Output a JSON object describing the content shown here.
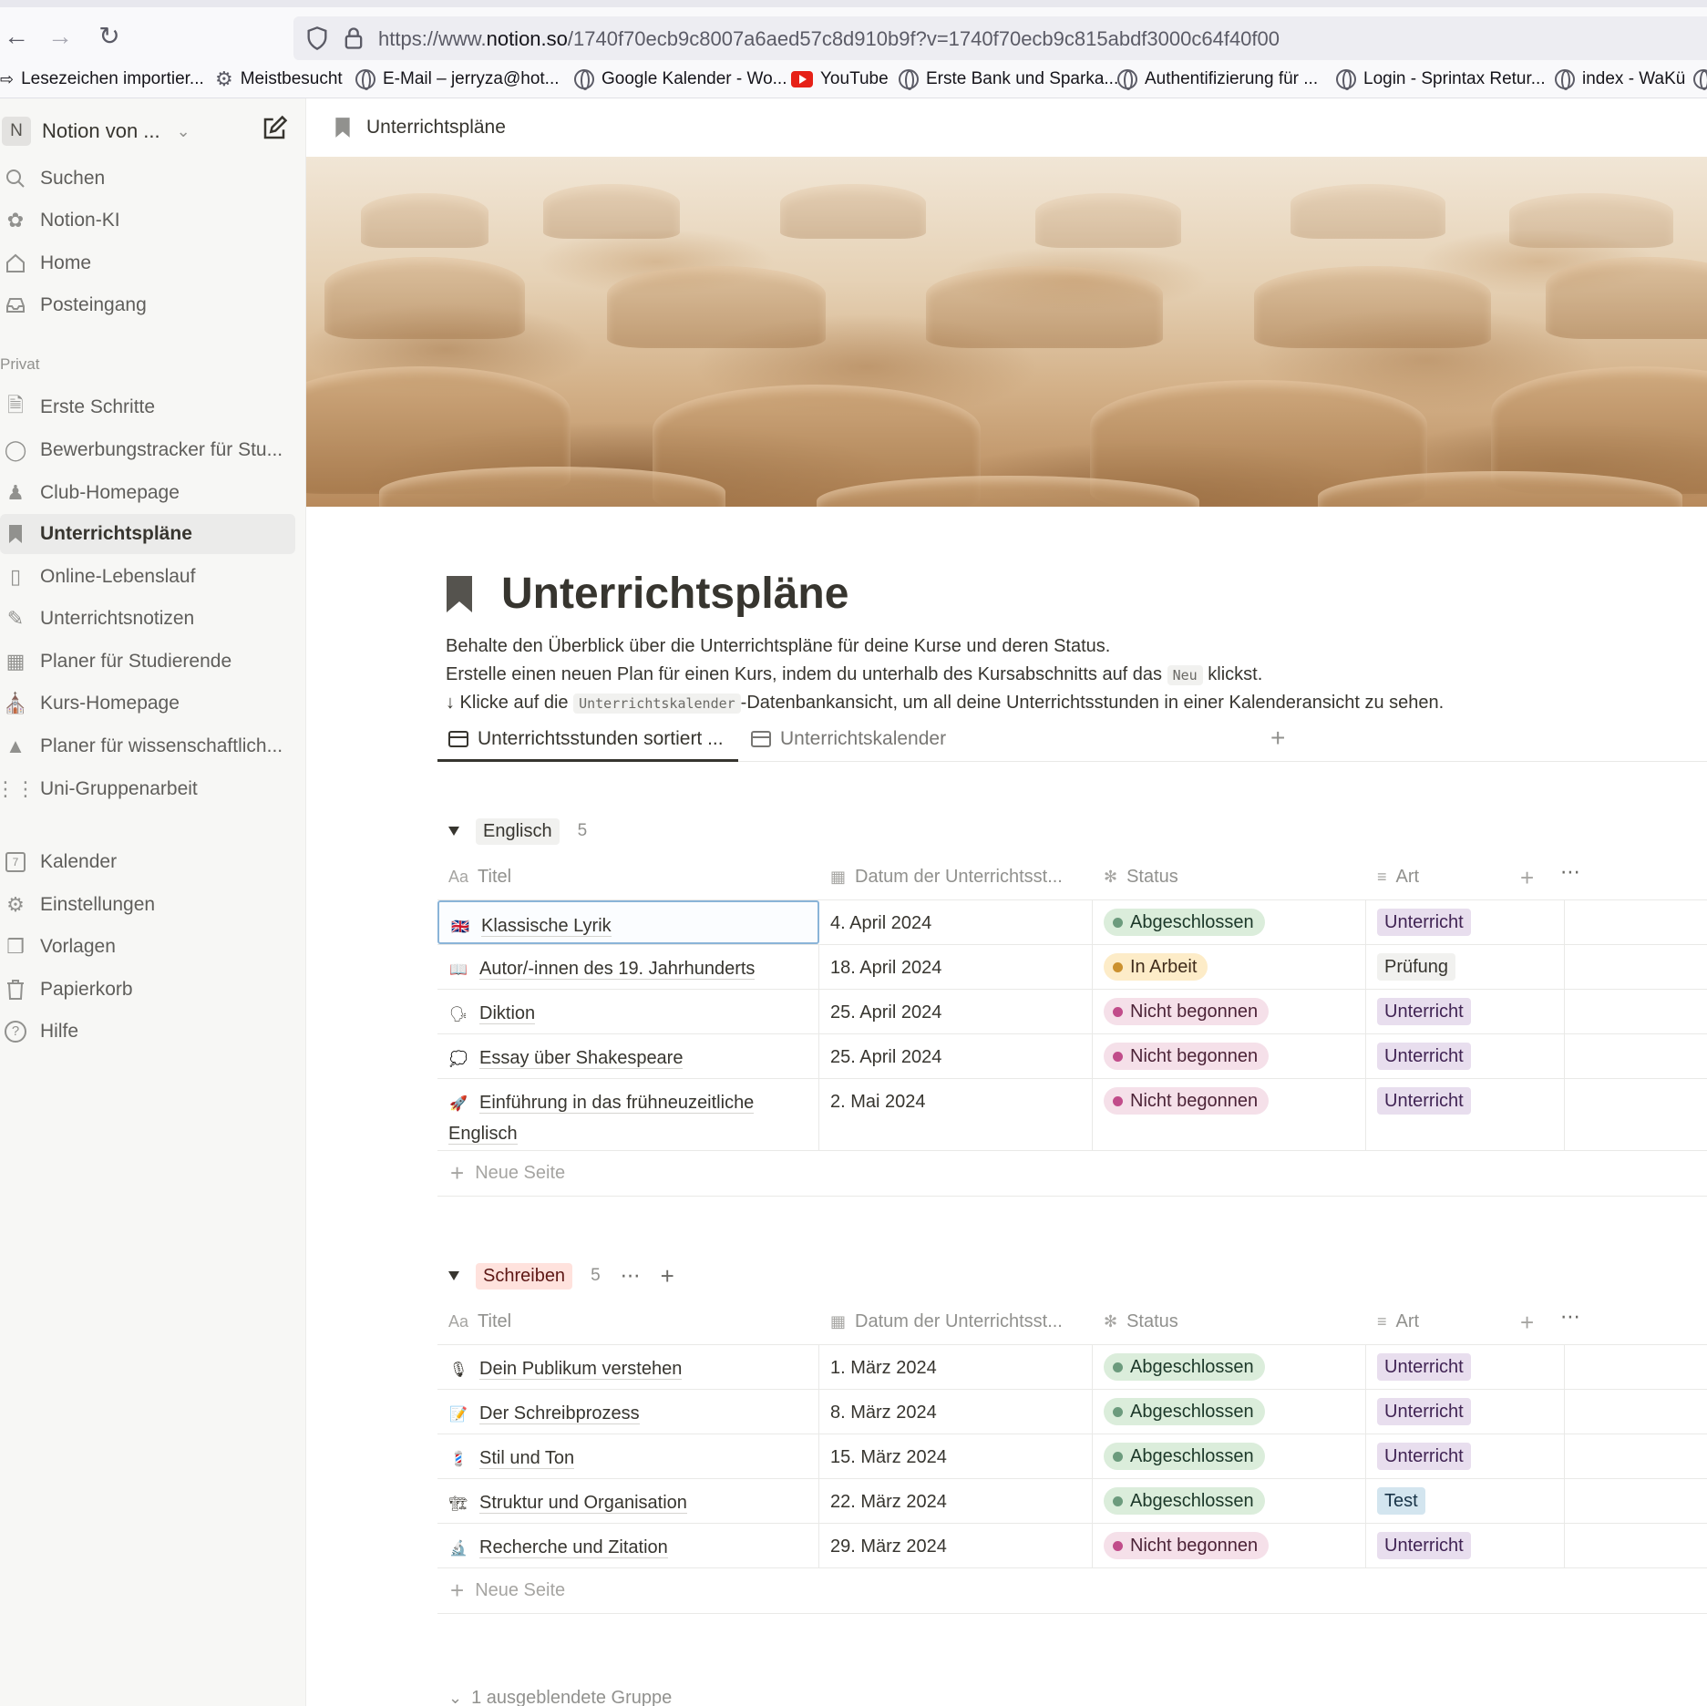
{
  "browser": {
    "url_prefix": "https://www.",
    "url_domain": "notion.so",
    "url_rest": "/1740f70ecb9c8007a6aed57c8d910b9f?v=1740f70ecb9c815abdf3000c64f40f00",
    "bookmarks": [
      {
        "label": "Lesezeichen importier...",
        "icon": "import-icon"
      },
      {
        "label": "Meistbesucht",
        "icon": "gear-icon"
      },
      {
        "label": "E-Mail – jerryza@hot...",
        "icon": "globe-icon"
      },
      {
        "label": "Google Kalender - Wo...",
        "icon": "globe-icon"
      },
      {
        "label": "YouTube",
        "icon": "youtube-icon"
      },
      {
        "label": "Erste Bank und Sparka...",
        "icon": "globe-icon"
      },
      {
        "label": "Authentifizierung für ...",
        "icon": "globe-icon"
      },
      {
        "label": "Login - Sprintax Retur...",
        "icon": "globe-icon"
      },
      {
        "label": "index - WaKü",
        "icon": "globe-icon"
      }
    ]
  },
  "sidebar": {
    "workspace_initial": "N",
    "workspace_name": "Notion von ...",
    "top_items": [
      {
        "label": "Suchen",
        "icon": "search-icon"
      },
      {
        "label": "Notion-KI",
        "icon": "ai-icon"
      },
      {
        "label": "Home",
        "icon": "home-icon"
      },
      {
        "label": "Posteingang",
        "icon": "inbox-icon"
      }
    ],
    "section_label": "Privat",
    "pages": [
      {
        "label": "Erste Schritte",
        "icon": "document-icon"
      },
      {
        "label": "Bewerbungstracker für Stu...",
        "icon": "binoculars-icon"
      },
      {
        "label": "Club-Homepage",
        "icon": "people-icon"
      },
      {
        "label": "Unterrichtspläne",
        "icon": "bookmark-icon",
        "active": true
      },
      {
        "label": "Online-Lebenslauf",
        "icon": "note-icon"
      },
      {
        "label": "Unterrichtsnotizen",
        "icon": "pencil-icon"
      },
      {
        "label": "Planer für Studierende",
        "icon": "calendar-icon"
      },
      {
        "label": "Kurs-Homepage",
        "icon": "school-icon"
      },
      {
        "label": "Planer für wissenschaftlich...",
        "icon": "graduation-cap-icon"
      },
      {
        "label": "Uni-Gruppenarbeit",
        "icon": "group-icon"
      }
    ],
    "bottom_items": [
      {
        "label": "Kalender",
        "icon": "calendar-7-icon",
        "icon_text": "7"
      },
      {
        "label": "Einstellungen",
        "icon": "gear-icon"
      },
      {
        "label": "Vorlagen",
        "icon": "templates-icon"
      },
      {
        "label": "Papierkorb",
        "icon": "trash-icon"
      },
      {
        "label": "Hilfe",
        "icon": "help-icon"
      }
    ]
  },
  "main": {
    "breadcrumb": "Unterrichtspläne",
    "title": "Unterrichtspläne",
    "desc1": "Behalte den Überblick über die Unterrichtspläne für deine Kurse und deren Status.",
    "desc2_a": "Erstelle einen neuen Plan für einen Kurs, indem du unterhalb des Kursabschnitts auf das ",
    "desc2_code": "Neu",
    "desc2_b": " klickst.",
    "desc3_a": "↓ Klicke auf die ",
    "desc3_code": "Unterrichtskalender",
    "desc3_b": "-Datenbankansicht, um all deine Unterrichtsstunden in einer Kalenderansicht zu sehen.",
    "tabs": [
      {
        "label": "Unterrichtsstunden sortiert ..."
      },
      {
        "label": "Unterrichtskalender"
      }
    ],
    "columns": {
      "title_prefix": "Aa",
      "title": "Titel",
      "date": "Datum der Unterrichtsst...",
      "status": "Status",
      "type": "Art"
    },
    "new_page_label": "Neue Seite",
    "groups": [
      {
        "name": "Englisch",
        "count": "5",
        "rows": [
          {
            "emoji": "🇬🇧",
            "title": "Klassische Lyrik",
            "date": "4. April 2024",
            "status": "Abgeschlossen",
            "type": "Unterricht"
          },
          {
            "emoji": "📖",
            "title": "Autor/-innen des 19. Jahrhunderts",
            "date": "18. April 2024",
            "status": "In Arbeit",
            "type": "Prüfung"
          },
          {
            "emoji": "🗣",
            "title": "Diktion",
            "date": "25. April 2024",
            "status": "Nicht begonnen",
            "type": "Unterricht"
          },
          {
            "emoji": "💭",
            "title": "Essay über Shakespeare",
            "date": "25. April 2024",
            "status": "Nicht begonnen",
            "type": "Unterricht"
          },
          {
            "emoji": "🚀",
            "title": "Einführung in das frühneuzeitliche Englisch",
            "date": "2. Mai 2024",
            "status": "Nicht begonnen",
            "type": "Unterricht"
          }
        ]
      },
      {
        "name": "Schreiben",
        "count": "5",
        "rows": [
          {
            "emoji": "🎙",
            "title": "Dein Publikum verstehen",
            "date": "1. März 2024",
            "status": "Abgeschlossen",
            "type": "Unterricht"
          },
          {
            "emoji": "📝",
            "title": "Der Schreibprozess",
            "date": "8. März 2024",
            "status": "Abgeschlossen",
            "type": "Unterricht"
          },
          {
            "emoji": "💈",
            "title": "Stil und Ton",
            "date": "15. März 2024",
            "status": "Abgeschlossen",
            "type": "Unterricht"
          },
          {
            "emoji": "🏗",
            "title": "Struktur und Organisation",
            "date": "22. März 2024",
            "status": "Abgeschlossen",
            "type": "Test"
          },
          {
            "emoji": "🔬",
            "title": "Recherche und Zitation",
            "date": "29. März 2024",
            "status": "Nicht begonnen",
            "type": "Unterricht"
          }
        ]
      }
    ],
    "hidden_groups_label": "1 ausgeblendete Gruppe",
    "colors": {
      "group_englisch_bg": "#f1f1ef",
      "group_schreiben_bg": "#ffe2dd",
      "status_done": "#dbeddb",
      "status_progress": "#fdecc8",
      "status_not_started": "#f5e0e9"
    }
  }
}
